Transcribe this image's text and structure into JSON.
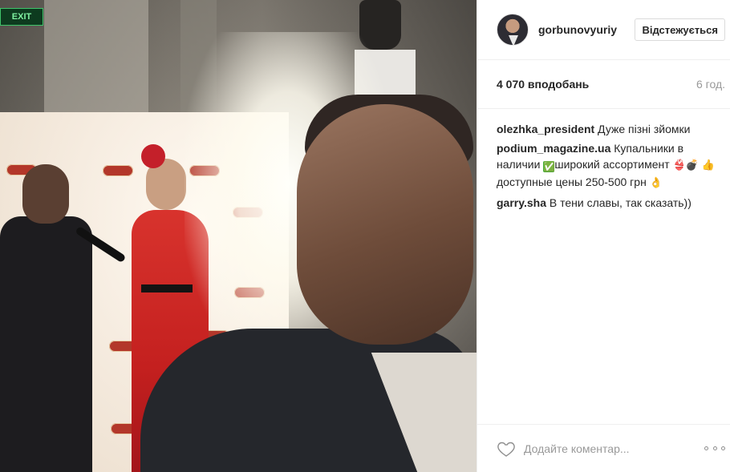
{
  "post": {
    "exit_sign": "EXIT",
    "user": {
      "username": "gorbunovyuriy",
      "follow_label": "Відстежується"
    },
    "stats": {
      "likes": "4 070 вподобань",
      "time": "6 год."
    },
    "comments": [
      {
        "author": "olezhka_president",
        "text": "Дуже пізні зйомки"
      },
      {
        "author": "podium_magazine.ua",
        "text_1": "Купальники в наличии",
        "text_2": "широкий ассортимент",
        "text_3": "доступные цены 250-500 грн",
        "emoji_after_check": "✅",
        "emoji_swimwear": "👙💣",
        "emoji_thumb": "👍",
        "emoji_ok": "👌"
      },
      {
        "author": "garry.sha",
        "text": "В тени славы, так сказать))"
      }
    ],
    "footer": {
      "comment_placeholder": "Додайте коментар..."
    },
    "icons": {
      "like": "heart-icon",
      "options": "more-options-icon"
    },
    "colors": {
      "border": "#efefef",
      "text": "#262626",
      "muted": "#999999"
    }
  }
}
